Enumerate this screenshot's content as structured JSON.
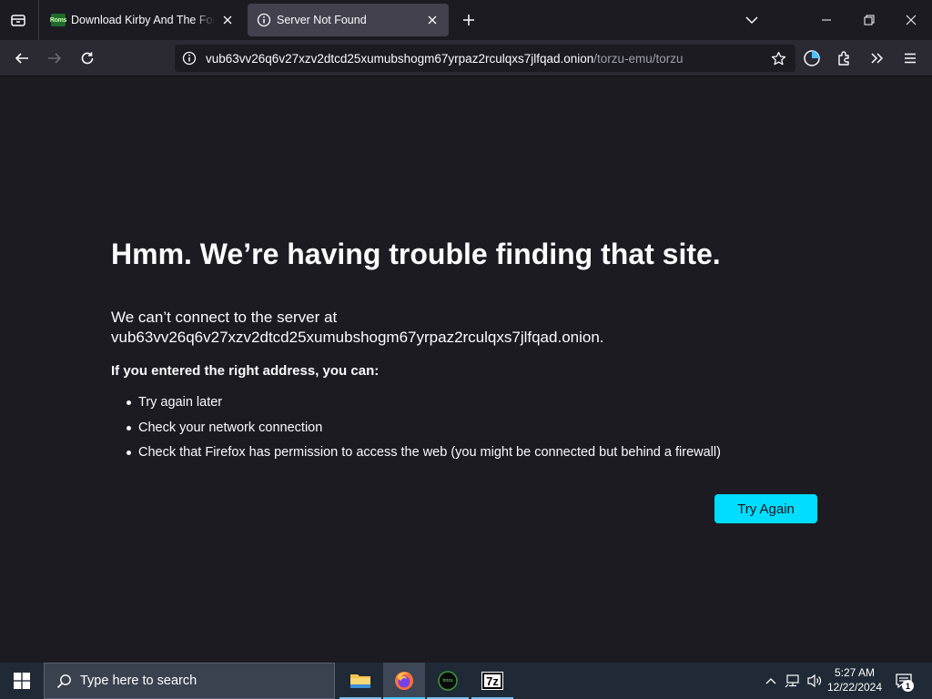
{
  "browser": {
    "tabs": [
      {
        "title": "Download Kirby And The Forgotten Land",
        "favicon_text": "Roms",
        "favicon": "roms-favicon-icon"
      },
      {
        "title": "Server Not Found",
        "favicon": "info-icon",
        "active": true
      }
    ],
    "url": {
      "host": "vub63vv26q6v27xzv2dtcd25xumubshogm67yrpaz2rculqxs7jlfqad.onion",
      "path": "/torzu-emu/torzu"
    }
  },
  "error_page": {
    "title": "Hmm. We’re having trouble finding that site.",
    "description_line1": "We can’t connect to the server at",
    "description_line2": "vub63vv26q6v27xzv2dtcd25xumubshogm67yrpaz2rculqxs7jlfqad.onion.",
    "subheading": "If you entered the right address, you can:",
    "suggestions": [
      "Try again later",
      "Check your network connection",
      "Check that Firefox has permission to access the web (you might be connected but behind a firewall)"
    ],
    "button_label": "Try Again"
  },
  "taskbar": {
    "search_placeholder": "Type here to search",
    "apps": [
      "file-explorer",
      "firefox",
      "emulator",
      "7-zip"
    ],
    "app_7z_label": "7z",
    "emu_label": "torzu",
    "clock_time": "5:27 AM",
    "clock_date": "12/22/2024",
    "notification_count": "1"
  },
  "colors": {
    "page_bg": "#1c1b22",
    "toolbar_bg": "#2b2a33",
    "accent_button": "#00ddff",
    "taskbar_bg": "#1f2a36"
  }
}
